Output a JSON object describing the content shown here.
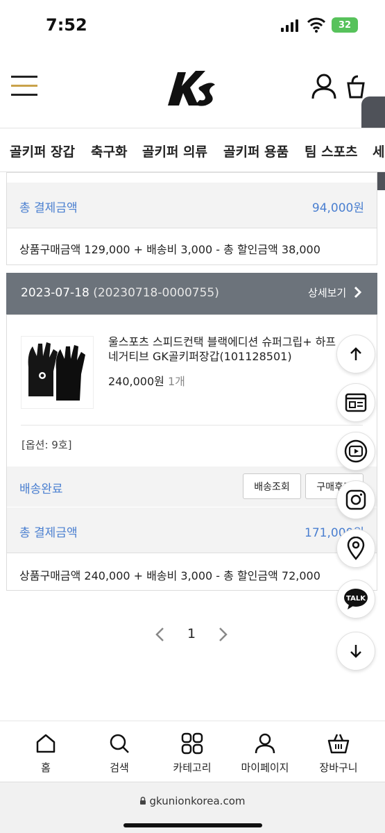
{
  "status_bar": {
    "time": "7:52",
    "battery": "32"
  },
  "header": {
    "logo_icon": "ks-logo",
    "brand_color": "#c9a24a"
  },
  "categories": [
    "골키퍼 장갑",
    "축구화",
    "골키퍼 의류",
    "골키퍼 용품",
    "팀 스포츠",
    "세"
  ],
  "order_prev": {
    "total_label": "총 결제금액",
    "total_value": "94,000원",
    "breakdown": "상품구매금액 129,000 + 배송비 3,000 - 총 할인금액 38,000"
  },
  "order": {
    "date": "2023-07-18",
    "order_no": "(20230718-0000755)",
    "detail_link": "상세보기",
    "product_name": "울스포츠 스피드컨택 블랙에디션 슈퍼그립+ 하프 네거티브 GK골키퍼장갑(101128501)",
    "price": "240,000원",
    "qty": "1개",
    "option": "[옵션: 9호]",
    "status": "배송완료",
    "btn_track": "배송조회",
    "btn_review": "구매후기",
    "total_label": "총 결제금액",
    "total_value": "171,000원",
    "breakdown": "상품구매금액 240,000 + 배송비 3,000 - 총 할인금액 72,000"
  },
  "pagination": {
    "current": "1"
  },
  "floating": [
    "arrow-up-icon",
    "news-icon",
    "youtube-icon",
    "instagram-icon",
    "location-icon",
    "kakao-talk-icon",
    "arrow-down-icon"
  ],
  "kakao_label": "TALK",
  "bottom_nav": [
    {
      "label": "홈",
      "icon": "home-icon"
    },
    {
      "label": "검색",
      "icon": "search-icon"
    },
    {
      "label": "카테고리",
      "icon": "category-icon"
    },
    {
      "label": "마이페이지",
      "icon": "user-icon"
    },
    {
      "label": "장바구니",
      "icon": "cart-icon"
    }
  ],
  "browser": {
    "url": "gkunionkorea.com"
  },
  "colors": {
    "accent_blue": "#4a7fd0",
    "order_header": "#6c737b"
  }
}
